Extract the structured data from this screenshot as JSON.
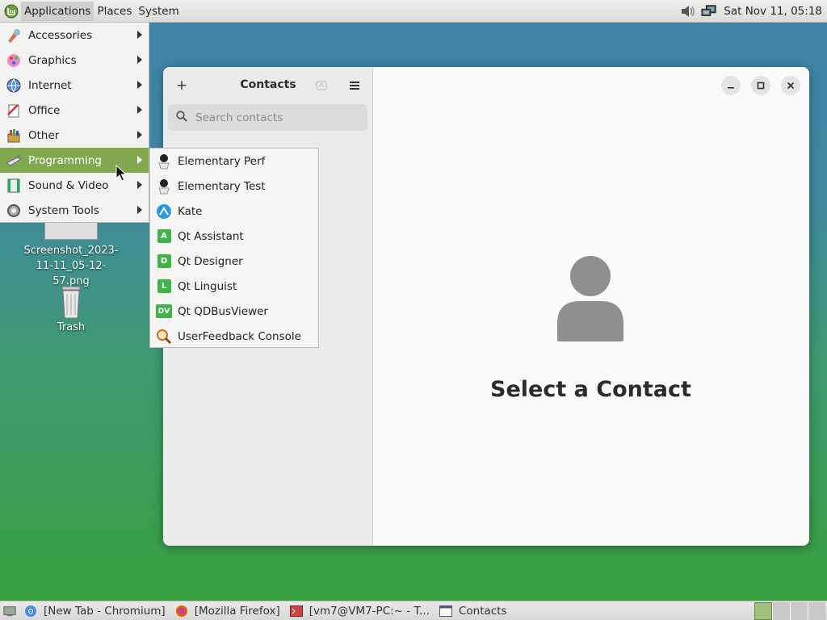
{
  "top_panel": {
    "menus": [
      "Applications",
      "Places",
      "System"
    ],
    "clock": "Sat Nov 11, 05:18"
  },
  "desktop_icons": [
    {
      "label": "Screenshot_2023-11-11_05-12-57.png",
      "icon": "image-file-icon"
    },
    {
      "label": "Trash",
      "icon": "trash-icon"
    }
  ],
  "app_menu": {
    "items": [
      {
        "label": "Accessories",
        "icon": "accessories-icon"
      },
      {
        "label": "Graphics",
        "icon": "graphics-icon"
      },
      {
        "label": "Internet",
        "icon": "internet-globe-icon"
      },
      {
        "label": "Office",
        "icon": "office-icon"
      },
      {
        "label": "Other",
        "icon": "other-icon"
      },
      {
        "label": "Programming",
        "icon": "programming-icon",
        "selected": true
      },
      {
        "label": "Sound & Video",
        "icon": "sound-video-icon"
      },
      {
        "label": "System Tools",
        "icon": "system-tools-icon"
      }
    ]
  },
  "programming_submenu": {
    "items": [
      {
        "label": "Elementary Perf",
        "icon": "elementary-perf-icon"
      },
      {
        "label": "Elementary Test",
        "icon": "elementary-test-icon"
      },
      {
        "label": "Kate",
        "icon": "kate-icon"
      },
      {
        "label": "Qt Assistant",
        "icon": "qt-assistant-icon",
        "glyph": "A"
      },
      {
        "label": "Qt Designer",
        "icon": "qt-designer-icon",
        "glyph": "D"
      },
      {
        "label": "Qt Linguist",
        "icon": "qt-linguist-icon",
        "glyph": "L"
      },
      {
        "label": "Qt QDBusViewer",
        "icon": "qt-qdbusviewer-icon",
        "glyph": "DV"
      },
      {
        "label": "UserFeedback Console",
        "icon": "userfeedback-console-icon"
      }
    ]
  },
  "contacts_window": {
    "title": "Contacts",
    "add_button": "+",
    "search_placeholder": "Search contacts",
    "empty_state_title": "Select a Contact"
  },
  "taskbar": {
    "tasks": [
      {
        "label": "[New Tab - Chromium]",
        "icon": "chromium-icon"
      },
      {
        "label": "[Mozilla Firefox]",
        "icon": "firefox-icon"
      },
      {
        "label": "[vm7@VM7-PC:~ - T...",
        "icon": "terminal-icon"
      },
      {
        "label": "Contacts",
        "icon": "window-icon"
      }
    ]
  },
  "colors": {
    "menu_selected": "#80a94f",
    "qt_green": "#41b34b"
  }
}
